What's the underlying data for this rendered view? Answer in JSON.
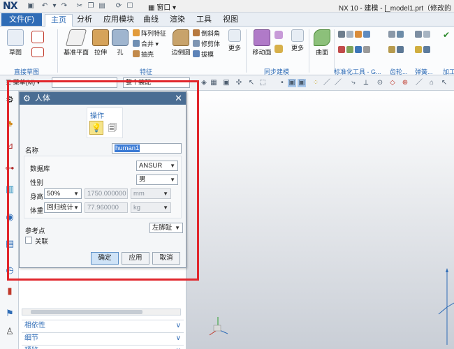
{
  "app": {
    "logo": "NX",
    "window_menu": "窗口",
    "title": "NX 10 - 建模 - [_model1.prt（修改的"
  },
  "menu": {
    "file": "文件(F)",
    "tabs": [
      "主页",
      "分析",
      "应用模块",
      "曲线",
      "渲染",
      "工具",
      "视图"
    ]
  },
  "ribbon": {
    "sketch": "草图",
    "datum_plane": "基准平面",
    "extrude": "拉伸",
    "hole": "孔",
    "pattern_feature": "阵列特征",
    "unite": "合并",
    "shell": "抽壳",
    "edge_blend": "边倒圆",
    "chamfer": "倒斜角",
    "trim_body": "修剪体",
    "draft": "拔模",
    "more1": "更多",
    "move_face": "移动面",
    "more2": "更多",
    "surface": "曲面",
    "groups": {
      "direct_sketch": "直接草图",
      "feature": "特征",
      "sync_modeling": "同步建模",
      "std_parts": "标准化工具 - G...",
      "gear": "齿轮...",
      "spring": "弹簧...",
      "machining": "加工"
    }
  },
  "selection_bar": {
    "menu": "菜单(M)",
    "filter": "",
    "scope": "整个装配"
  },
  "dialog": {
    "title": "人体",
    "operation_label": "操作",
    "name_label": "名称",
    "name_value": "human1",
    "database_label": "数据库",
    "database_value": "ANSUR",
    "gender_label": "性别",
    "gender_value": "男",
    "height_label": "身高",
    "height_percent": "50%",
    "height_value": "1750.000000",
    "height_unit": "mm",
    "weight_label": "体重",
    "weight_mode": "回归统计",
    "weight_value": "77.960000",
    "weight_unit": "kg",
    "reference_label": "参考点",
    "reference_value": "左脚趾",
    "associative_label": "关联",
    "ok": "确定",
    "apply": "应用",
    "cancel": "取消"
  },
  "navigator": {
    "dependencies": "相依性",
    "details": "细节",
    "preview": "预览"
  },
  "colors": {
    "accent": "#2f6cb6",
    "dialog_title": "#4a6d93",
    "highlight": "#e1262c"
  }
}
